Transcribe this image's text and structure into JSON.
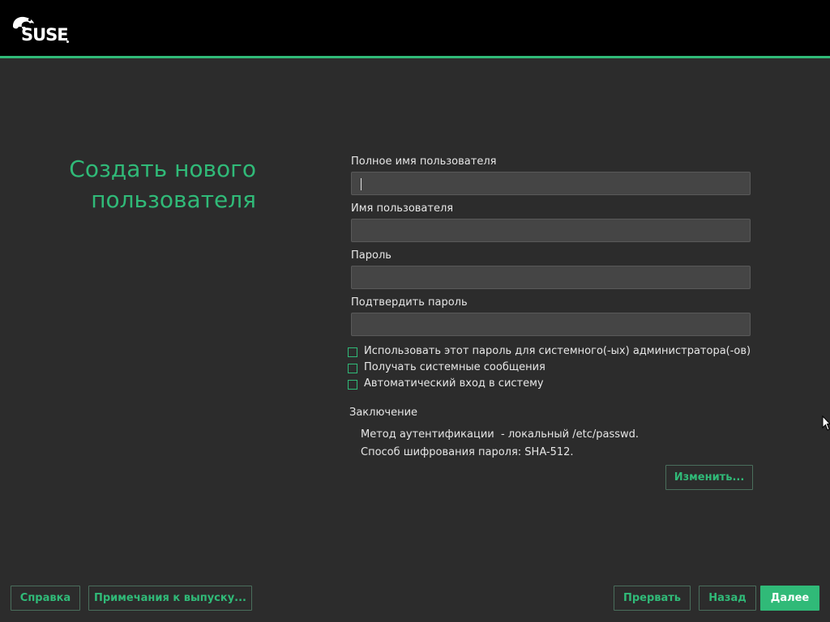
{
  "header": {
    "brand": "SUSE",
    "accent_color": "#30ba78",
    "background_color": "#000000"
  },
  "page": {
    "title_line1": "Создать нового",
    "title_line2": "пользователя"
  },
  "form": {
    "full_name": {
      "label": "Полное имя пользователя",
      "value": ""
    },
    "username": {
      "label": "Имя пользователя",
      "value": ""
    },
    "password": {
      "label": "Пароль",
      "value": ""
    },
    "confirm_password": {
      "label": "Подтвердить пароль",
      "value": ""
    }
  },
  "options": [
    {
      "label": "Использовать этот пароль для системного(-ых) администратора(-ов)",
      "checked": false
    },
    {
      "label": "Получать системные сообщения",
      "checked": false
    },
    {
      "label": "Автоматический вход в систему",
      "checked": false
    }
  ],
  "summary": {
    "title": "Заключение",
    "auth_method": "Метод аутентификации  - локальный /etc/passwd.",
    "encryption": "Способ шифрования пароля: SHA-512.",
    "change_button": "Изменить..."
  },
  "footer": {
    "help": "Справка",
    "release_notes": "Примечания к выпуску...",
    "abort": "Прервать",
    "back": "Назад",
    "next": "Далее"
  }
}
